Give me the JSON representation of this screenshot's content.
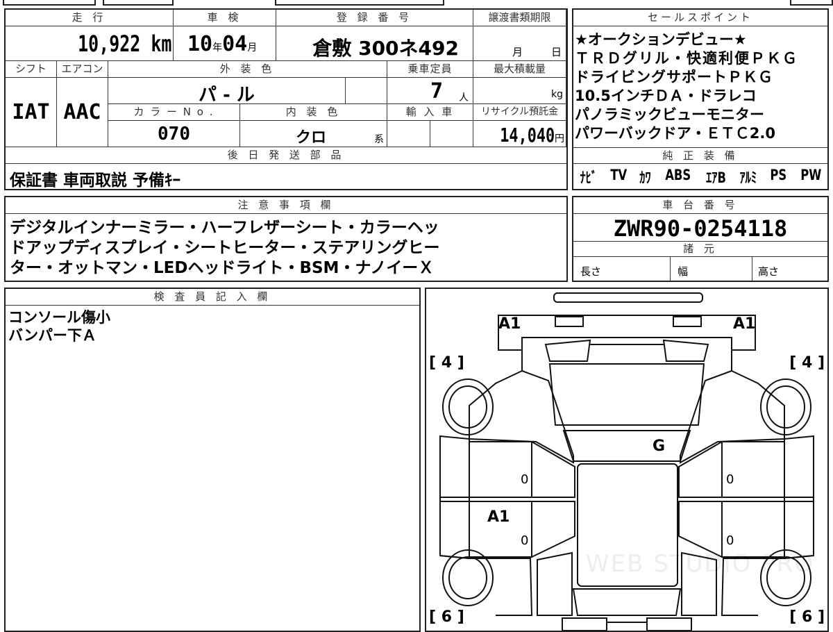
{
  "header": {
    "mileage_label": "走 行",
    "inspection_label": "車 検",
    "registration_label": "登 録 番 号",
    "transfer_deadline_label": "譲渡書類期限",
    "shift_label": "シフト",
    "aircon_label": "エアコン",
    "exterior_label": "外 装 色",
    "capacity_label": "乗車定員",
    "max_load_label": "最大積載量",
    "color_no_label": "カ ラ ー N o .",
    "interior_label": "内 装 色",
    "import_label": "輸 入 車",
    "recycle_label": "リサイクル預託金",
    "delivery_label": "後 日 発 送 部 品"
  },
  "vehicle": {
    "mileage": "10,922",
    "mileage_unit": "km",
    "inspection_year": "10",
    "year_unit": "年",
    "inspection_month": "04",
    "month_unit": "月",
    "registration": "倉敷 300ネ492",
    "deadline_month": "月",
    "deadline_day": "日",
    "shift": "IAT",
    "aircon": "AAC",
    "exterior_color": "パ - ル",
    "capacity": "7",
    "capacity_unit": "人",
    "max_load_unit": "kg",
    "color_no": "070",
    "interior_color": "クロ",
    "interior_suffix": "系",
    "recycle_fee": "14,040",
    "recycle_unit": "円",
    "delivery_parts": "保証書 車両取説 予備ｷｰ"
  },
  "sales": {
    "label": "セールスポイント",
    "lines": [
      "★オークションデビュー★",
      "ＴＲＤグリル・快適利便ＰＫＧ",
      "ドライビングサポートＰＫＧ",
      "10.5インチＤＡ・ドラレコ",
      "パノラミックビューモニター",
      "パワーバックドア・ＥＴＣ2.0"
    ]
  },
  "equipment": {
    "label": "純 正 装 備",
    "items": [
      "ﾅﾋﾞ",
      "TV",
      "ｶﾜ",
      "ABS",
      "ｴｱB",
      "ｱﾙﾐ",
      "PS",
      "PW"
    ]
  },
  "notes": {
    "label": "注 意 事 項 欄",
    "lines": [
      "デジタルインナーミラー・ハーフレザーシート・カラーヘッ",
      "ドアップディスプレイ・シートヒーター・ステアリングヒー",
      "ター・オットマン・LEDヘッドライト・BSM・ナノイーＸ"
    ]
  },
  "chassis": {
    "label": "車 台 番 号",
    "number": "ZWR90-0254118",
    "spec_label": "諸 元",
    "length_label": "長さ",
    "width_label": "幅",
    "height_label": "高さ"
  },
  "inspector": {
    "label": "検 査 員 記 入 欄",
    "lines": [
      "コンソール傷小",
      "バンパー下Ａ"
    ]
  },
  "diagram": {
    "marks": {
      "front_left": "A1",
      "front_right": "A1",
      "windshield": "G",
      "rear_door_left": "A1",
      "door_fl": "0",
      "door_rl": "0",
      "door_fr": "0",
      "door_rr": "0"
    },
    "tires": {
      "front_left": "4",
      "front_right": "4",
      "rear_left": "6",
      "rear_right": "6"
    },
    "watermark": "WEB STUDIO PRO"
  }
}
